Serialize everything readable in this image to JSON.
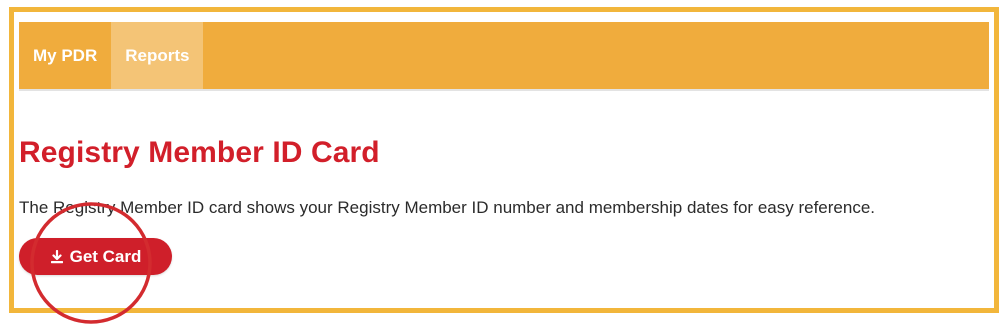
{
  "nav": {
    "items": [
      {
        "label": "My PDR",
        "active": false
      },
      {
        "label": "Reports",
        "active": true
      }
    ]
  },
  "main": {
    "title": "Registry Member ID Card",
    "description": "The Registry Member ID card shows your Registry Member ID number and membership dates for easy reference.",
    "button_label": "Get Card",
    "button_icon": "download-icon"
  },
  "colors": {
    "frame_border": "#f2b63b",
    "nav_background": "#f0ac3d",
    "nav_active": "#f4c476",
    "accent_red": "#d21f2a",
    "annotation_circle": "#d32b2f"
  }
}
